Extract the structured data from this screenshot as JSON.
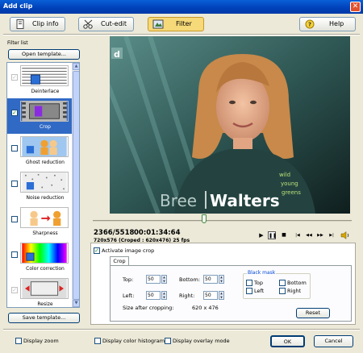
{
  "window": {
    "title": "Add clip"
  },
  "toolbar": {
    "clip_info": "Clip info",
    "cut_edit": "Cut-edit",
    "filter": "Filter",
    "help": "Help"
  },
  "sidebar": {
    "heading": "Filter list",
    "open_template": "Open template...",
    "save_template": "Save template...",
    "filters": [
      {
        "label": "Deinterlace",
        "checked": true,
        "enabled": false
      },
      {
        "label": "Crop",
        "checked": true,
        "enabled": true,
        "selected": true
      },
      {
        "label": "Ghost reduction",
        "checked": false,
        "enabled": true
      },
      {
        "label": "Noise reduction",
        "checked": false,
        "enabled": true
      },
      {
        "label": "Sharpness",
        "checked": false,
        "enabled": true
      },
      {
        "label": "Color correction",
        "checked": false,
        "enabled": true
      },
      {
        "label": "Resize",
        "checked": true,
        "enabled": false
      }
    ]
  },
  "preview": {
    "caption_first": "Bree",
    "caption_last": "Walters",
    "shirt_text": [
      "wild",
      "young",
      "greens"
    ],
    "frame_counter": "2366/5518",
    "timecode": "00:01:34:64",
    "info": "720x576 (Croped : 620x476) 25 fps",
    "position_fraction": 0.43
  },
  "crop": {
    "activate_label": "Activate image crop",
    "activate_checked": true,
    "tab": "Crop",
    "top_label": "Top:",
    "top_value": "50",
    "bottom_label": "Bottom:",
    "bottom_value": "50",
    "left_label": "Left:",
    "left_value": "50",
    "right_label": "Right:",
    "right_value": "50",
    "size_label": "Size after cropping:",
    "size_value": "620 x 476",
    "black_mask": {
      "title": "Black mask",
      "top": "Top",
      "bottom": "Bottom",
      "left": "Left",
      "right": "Right"
    },
    "reset": "Reset"
  },
  "footer": {
    "display_zoom": "Display zoom",
    "display_histogram": "Display color histogram",
    "display_overlay": "Display overlay mode",
    "ok": "OK",
    "cancel": "Cancel"
  },
  "colors": {
    "titlebar": "#0a5fd8",
    "active_tab": "#f6d978",
    "selection": "#316ac5"
  }
}
